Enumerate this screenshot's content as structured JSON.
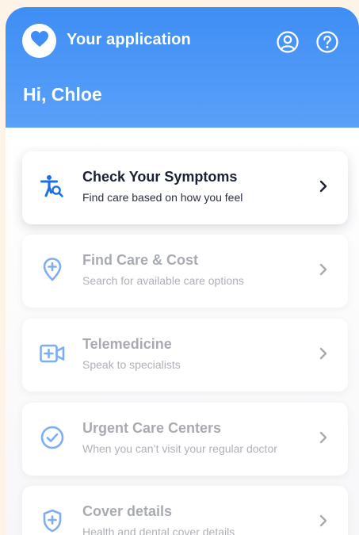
{
  "header": {
    "app_title": "Your application",
    "greeting": "Hi, Chloe",
    "logo_icon": "heart-icon",
    "profile_icon": "profile-icon",
    "help_icon": "help-icon"
  },
  "colors": {
    "primary": "#3f8ef5",
    "background": "#fdf3e7",
    "icon_blue": "#2f7df0",
    "text_dark": "#1a2133"
  },
  "menu": [
    {
      "title": "Check Your Symptoms",
      "subtitle": "Find care based on how you feel",
      "icon": "symptom-check-icon",
      "active": true
    },
    {
      "title": "Find Care & Cost",
      "subtitle": "Search for available care options",
      "icon": "location-plus-icon",
      "active": false
    },
    {
      "title": "Telemedicine",
      "subtitle": "Speak to specialists",
      "icon": "video-plus-icon",
      "active": false
    },
    {
      "title": "Urgent Care Centers",
      "subtitle": "When you can’t visit your regular doctor",
      "icon": "check-circle-icon",
      "active": false
    },
    {
      "title": "Cover details",
      "subtitle": "Health and dental cover details",
      "icon": "shield-plus-icon",
      "active": false
    }
  ]
}
